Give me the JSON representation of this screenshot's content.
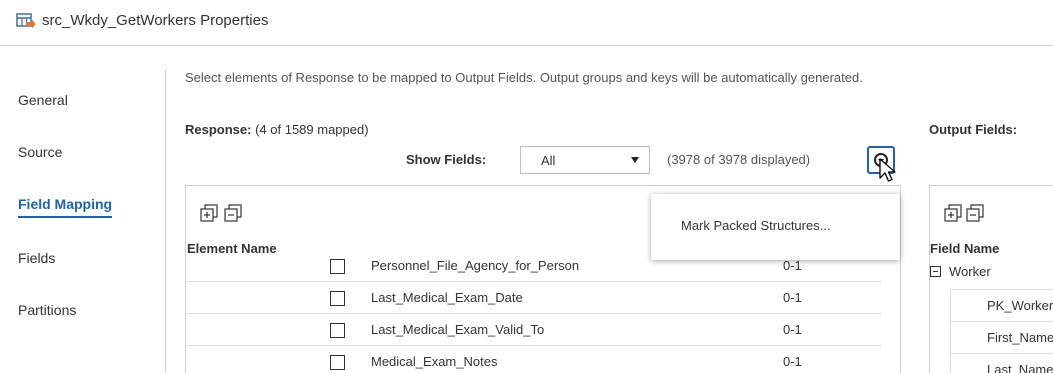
{
  "window": {
    "title": "src_Wkdy_GetWorkers Properties"
  },
  "nav": {
    "items": [
      {
        "label": "General"
      },
      {
        "label": "Source"
      },
      {
        "label": "Field Mapping"
      },
      {
        "label": "Fields"
      },
      {
        "label": "Partitions"
      }
    ],
    "active": "Field Mapping"
  },
  "mapping": {
    "instruction": "Select elements of Response to be mapped to Output Fields. Output groups and keys will be automatically generated.",
    "response_label": "Response:",
    "response_count": "(4 of 1589 mapped)",
    "show_fields_label": "Show Fields:",
    "show_fields_value": "All",
    "displayed_count": "(3978 of 3978 displayed)",
    "element_name_header": "Element Name",
    "rows": [
      {
        "name": "Personnel_File_Agency_for_Person",
        "cardinality": "0-1"
      },
      {
        "name": "Last_Medical_Exam_Date",
        "cardinality": "0-1"
      },
      {
        "name": "Last_Medical_Exam_Valid_To",
        "cardinality": "0-1"
      },
      {
        "name": "Medical_Exam_Notes",
        "cardinality": "0-1"
      }
    ],
    "popup_item": "Mark Packed Structures..."
  },
  "output": {
    "label": "Output Fields:",
    "field_name_header": "Field Name",
    "group": "Worker",
    "rows": [
      {
        "name": "PK_Worker"
      },
      {
        "name": "First_Name"
      },
      {
        "name": "Last_Name"
      }
    ]
  },
  "colors": {
    "accent": "#1b64b4",
    "border": "#cfcfcf",
    "icon_orange": "#e8792c",
    "icon_blue": "#3f6fb0"
  }
}
